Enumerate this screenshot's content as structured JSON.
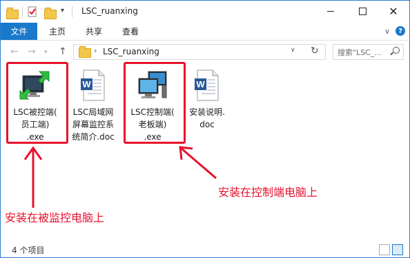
{
  "window": {
    "title": "LSC_ruanxing"
  },
  "ribbon": {
    "tabs": [
      "文件",
      "主页",
      "共享",
      "查看"
    ],
    "expand_label": "∨",
    "help_label": "?"
  },
  "address": {
    "path": "LSC_ruanxing",
    "search_placeholder": "搜索\"LSC_..."
  },
  "files": [
    {
      "label": "LSC被控端(\n员工端)\n.exe",
      "icon": "monitor-green-arrows-icon"
    },
    {
      "label": "LSC局域网\n屏幕监控系\n统简介.doc",
      "icon": "word-document-icon"
    },
    {
      "label": "LSC控制端(\n老板端)\n.exe",
      "icon": "two-monitors-icon"
    },
    {
      "label": "安装说明.\ndoc",
      "icon": "word-document-icon"
    }
  ],
  "annotations": {
    "control": "安装在控制端电脑上",
    "monitored": "安装在被监控电脑上"
  },
  "status": {
    "count": "4 个项目"
  },
  "colors": {
    "accent": "#1979ca",
    "annotation_red": "#e8112d"
  }
}
